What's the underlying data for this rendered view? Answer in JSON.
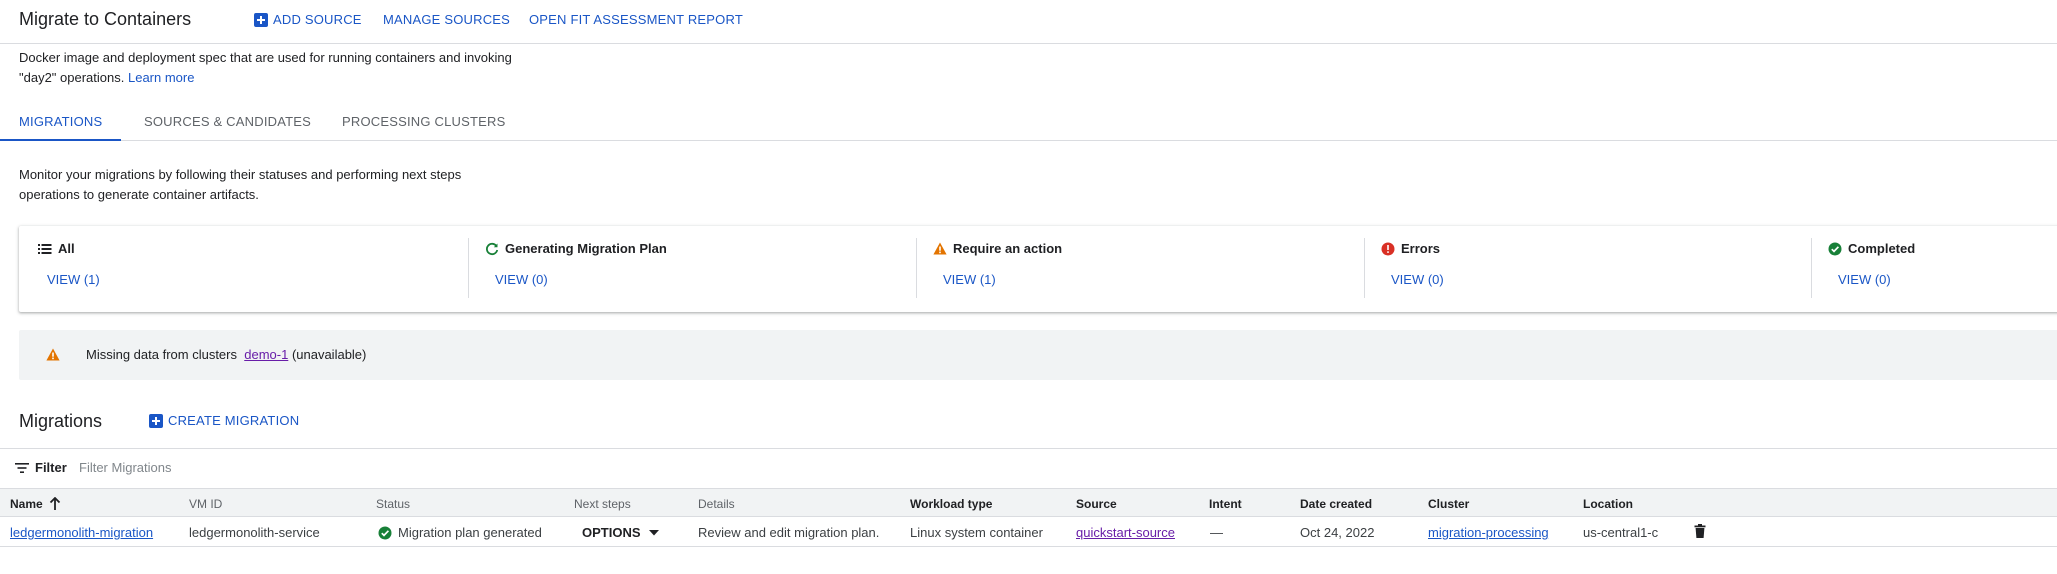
{
  "header": {
    "title": "Migrate to Containers",
    "add_source": "ADD SOURCE",
    "manage_sources": "MANAGE SOURCES",
    "open_fit": "OPEN FIT ASSESSMENT REPORT"
  },
  "intro": {
    "line1": "Docker image and deployment spec that are used for running containers and invoking",
    "line2_prefix": "\"day2\" operations.",
    "learn_more": "Learn more"
  },
  "tabs": [
    "MIGRATIONS",
    "SOURCES & CANDIDATES",
    "PROCESSING CLUSTERS"
  ],
  "monitor": {
    "line1": "Monitor your migrations by following their statuses and performing next steps",
    "line2": "operations to generate container artifacts."
  },
  "status_cards": [
    {
      "label": "All",
      "view": "VIEW (1)",
      "icon": "list-icon"
    },
    {
      "label": "Generating Migration Plan",
      "view": "VIEW (0)",
      "icon": "refresh-icon"
    },
    {
      "label": "Require an action",
      "view": "VIEW (1)",
      "icon": "warning-icon"
    },
    {
      "label": "Errors",
      "view": "VIEW (0)",
      "icon": "error-icon"
    },
    {
      "label": "Completed",
      "view": "VIEW (0)",
      "icon": "check-circle-icon"
    }
  ],
  "warning": {
    "prefix": "Missing data from clusters",
    "cluster": "demo-1",
    "suffix": "(unavailable)"
  },
  "migrations": {
    "title": "Migrations",
    "create": "CREATE MIGRATION",
    "filter_label": "Filter",
    "filter_placeholder": "Filter Migrations"
  },
  "table": {
    "headers": [
      "Name",
      "VM ID",
      "Status",
      "Next steps",
      "Details",
      "Workload type",
      "Source",
      "Intent",
      "Date created",
      "Cluster",
      "Location"
    ],
    "row": {
      "name": "ledgermonolith-migration",
      "vm_id": "ledgermonolith-service",
      "status": "Migration plan generated",
      "next_steps": "OPTIONS",
      "details": "Review and edit migration plan.",
      "workload_type": "Linux system container",
      "source": "quickstart-source",
      "intent": "—",
      "date_created": "Oct 24, 2022",
      "cluster": "migration-processing",
      "location": "us-central1-c"
    }
  },
  "colors": {
    "accent": "#1a56c6",
    "visited_link": "#681da8",
    "success": "#188038",
    "warning": "#e37400",
    "error": "#d93025"
  }
}
